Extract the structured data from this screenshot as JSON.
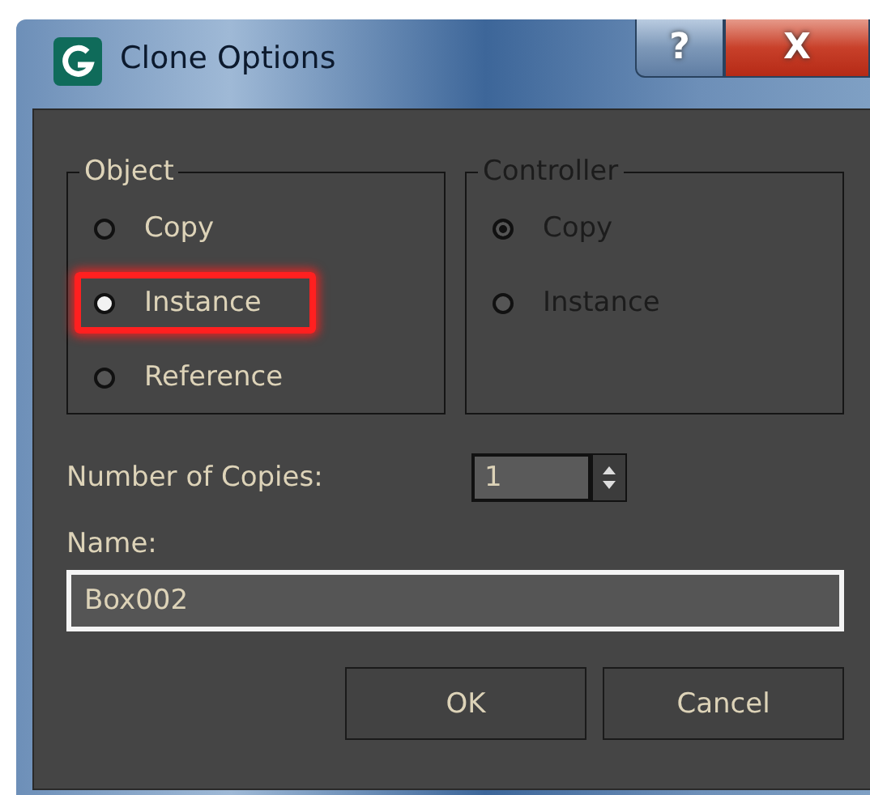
{
  "window": {
    "title": "Clone Options",
    "help": "?",
    "close": "X"
  },
  "groups": [
    {
      "title": "Object",
      "disabled": false,
      "options": [
        {
          "label": "Copy",
          "selected": false,
          "highlighted": false
        },
        {
          "label": "Instance",
          "selected": true,
          "highlighted": true
        },
        {
          "label": "Reference",
          "selected": false,
          "highlighted": false
        }
      ]
    },
    {
      "title": "Controller",
      "disabled": true,
      "options": [
        {
          "label": "Copy",
          "selected": true,
          "highlighted": false
        },
        {
          "label": "Instance",
          "selected": false,
          "highlighted": false
        }
      ]
    }
  ],
  "copies": {
    "label": "Number of Copies:",
    "value": "1"
  },
  "name": {
    "label": "Name:",
    "value": "Box002"
  },
  "buttons": [
    "OK",
    "Cancel"
  ]
}
